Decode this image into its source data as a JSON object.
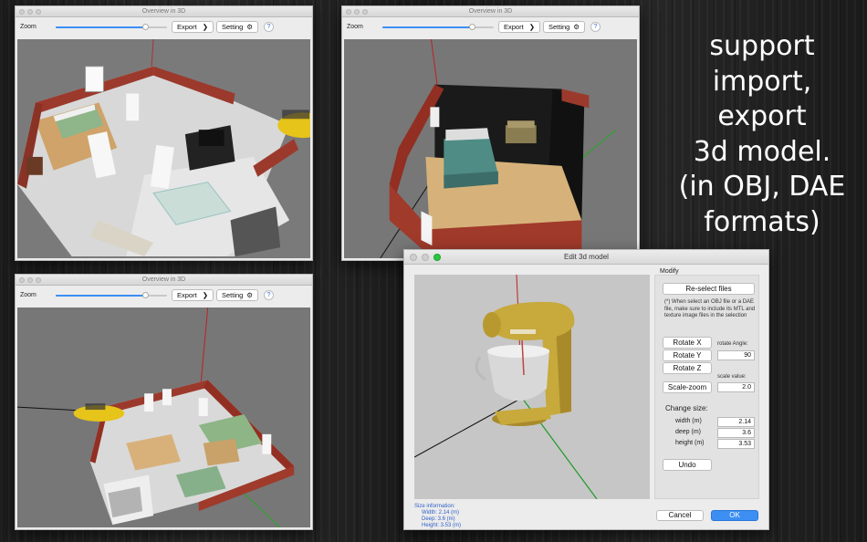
{
  "app": {
    "window_title": "Overview in 3D",
    "zoom_label": "Zoom",
    "export_label": "Export",
    "setting_label": "Setting",
    "help_glyph": "?",
    "zoom_level": 0.8
  },
  "promo": {
    "lines": [
      "support",
      "import,",
      "export",
      "3d model.",
      "(in OBJ, DAE",
      "formats)"
    ]
  },
  "editor": {
    "title": "Edit 3d model",
    "modify_label": "Modify",
    "reselect_label": "Re-select files",
    "note": "(*) When select an OBJ file or a DAE file, make sure to include its MTL and texture image files in the selection",
    "rotate_x_label": "Rotate X",
    "rotate_y_label": "Rotate Y",
    "rotate_z_label": "Rotate Z",
    "rotate_angle_label": "rotate Angle:",
    "rotate_angle_value": "90",
    "scale_zoom_label": "Scale-zoom",
    "scale_value_label": "scale value:",
    "scale_value": "2.0",
    "change_size_label": "Change size:",
    "width_label": "width (m)",
    "width_value": "2.14",
    "deep_label": "deep (m)",
    "deep_value": "3.6",
    "height_label": "height (m)",
    "height_value": "3.53",
    "undo_label": "Undo",
    "cancel_label": "Cancel",
    "ok_label": "OK",
    "size_info": {
      "heading": "Size information:",
      "width": "Width:  2.14 (m)",
      "deep": "Deep:   3.6 (m)",
      "height": "Height: 3.53 (m)"
    }
  },
  "colors": {
    "accent": "#3c8ef3",
    "brick": "#9b3a2c",
    "floor": "#c8a46a",
    "viewport_bg": "#777777",
    "mixer": "#c7a93c"
  }
}
